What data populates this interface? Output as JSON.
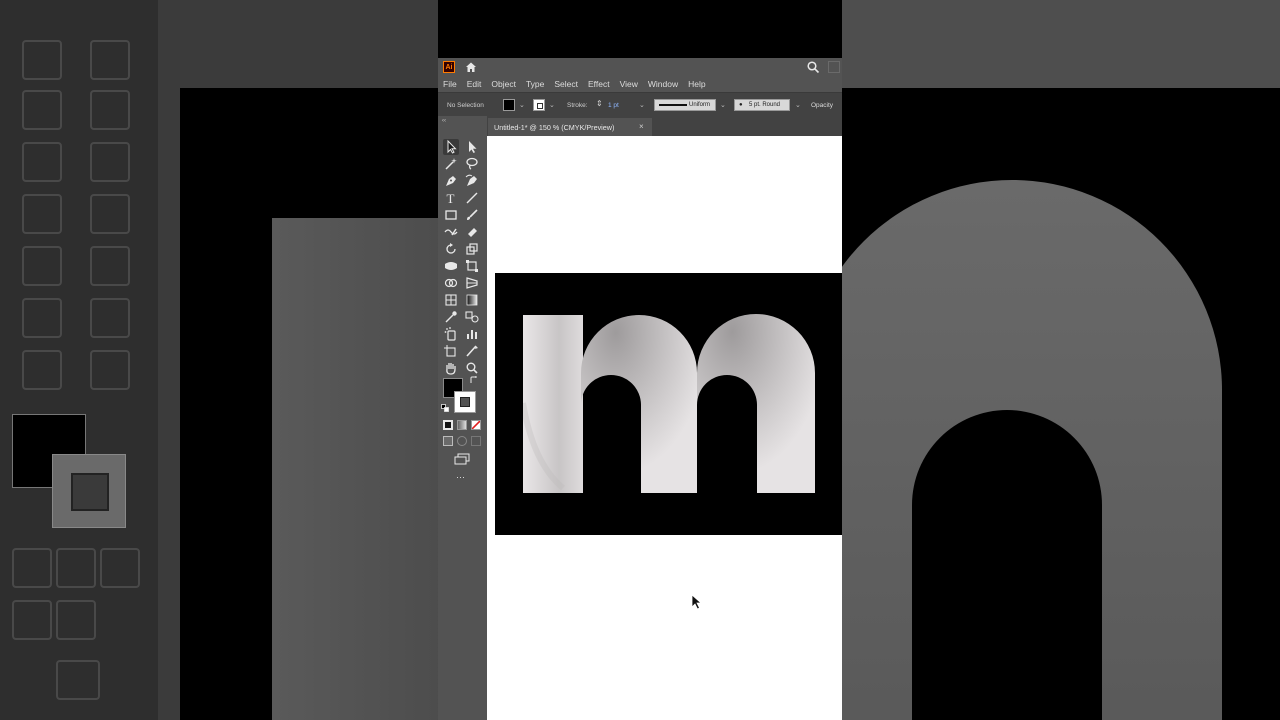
{
  "app": {
    "logo_text": "Ai",
    "brand_color": "#ff7c00",
    "menu": [
      "File",
      "Edit",
      "Object",
      "Type",
      "Select",
      "Effect",
      "View",
      "Window",
      "Help"
    ],
    "control_bar": {
      "selection_label": "No Selection",
      "stroke_label": "Stroke:",
      "stroke_weight": "1 pt",
      "profile_label": "Uniform",
      "brush_label": "5 pt. Round",
      "opacity_label": "Opacity"
    },
    "document_tab": {
      "title": "Untitled-1* @ 150 % (CMYK/Preview)",
      "close_glyph": "×"
    },
    "toolbar": {
      "grip": "‹‹",
      "more_glyph": "···",
      "tools": [
        "selection-tool",
        "direct-selection-tool",
        "magic-wand-tool",
        "lasso-tool",
        "pen-tool",
        "curvature-tool",
        "type-tool",
        "line-segment-tool",
        "rectangle-tool",
        "paintbrush-tool",
        "shaper-tool",
        "eraser-tool",
        "rotate-tool",
        "scale-tool",
        "width-tool",
        "free-transform-tool",
        "shape-builder-tool",
        "perspective-grid-tool",
        "mesh-tool",
        "gradient-tool",
        "eyedropper-tool",
        "blend-tool",
        "symbol-sprayer-tool",
        "column-graph-tool",
        "artboard-tool",
        "slice-tool",
        "hand-tool",
        "zoom-tool"
      ]
    },
    "fill_color": "#000000",
    "stroke_color": "#ffffff",
    "artwork": {
      "letter": "m",
      "background_color": "#000000"
    }
  }
}
